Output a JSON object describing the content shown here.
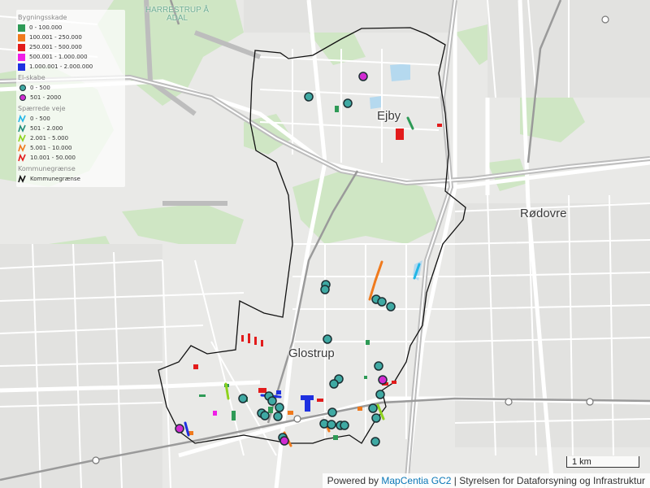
{
  "map": {
    "place_labels": {
      "ejby": "Ejby",
      "roedovre": "Rødovre",
      "glostrup": "Glostrup"
    },
    "area_labels": {
      "harrestrup_line1": "HARRESTRUP Å",
      "harrestrup_line2": "ADAL"
    },
    "scalebar": "1 km",
    "attribution": {
      "prefix": "Powered by",
      "link": "MapCentia GC2",
      "suffix": "| Styrelsen for Dataforsyning og Infrastruktur"
    },
    "colors": {
      "park_green": "#cfe6c4",
      "road_white": "#ffffff",
      "road_gray": "#b5b5b5",
      "rail": "#9a9a9a",
      "water_blue": "#b5d9ef",
      "boundary": "#111111",
      "elskab_teal": "#3fa9a3",
      "elskab_magenta": "#d12bd2"
    }
  },
  "legend": {
    "building_title": "Bygningsskade",
    "building_items": [
      {
        "label": "0 - 100.000",
        "color": "#2e9a56"
      },
      {
        "label": "100.001 - 250.000",
        "color": "#f07a1d"
      },
      {
        "label": "250.001 - 500.000",
        "color": "#e21b1b"
      },
      {
        "label": "500.001 - 1.000.000",
        "color": "#ef1ee6"
      },
      {
        "label": "1.000.001 - 2.000.000",
        "color": "#1e30e0"
      }
    ],
    "elskabe_title": "El-skabe",
    "elskabe_items": [
      {
        "label": "0 - 500",
        "color": "#3fa9a3"
      },
      {
        "label": "501 - 2000",
        "color": "#d12bd2"
      }
    ],
    "roads_title": "Spærrede veje",
    "road_items": [
      {
        "label": "0 - 500",
        "color": "#22b6e6"
      },
      {
        "label": "501 - 2.000",
        "color": "#1e8d7a"
      },
      {
        "label": "2.001 - 5.000",
        "color": "#8ed21d"
      },
      {
        "label": "5.001 - 10.000",
        "color": "#f07a1d"
      },
      {
        "label": "10.001 - 50.000",
        "color": "#e21b1b"
      }
    ],
    "boundary_title": "Kommunegrænse",
    "boundary_items": [
      {
        "label": "Kommunegrænse",
        "color": "#111111"
      }
    ]
  }
}
